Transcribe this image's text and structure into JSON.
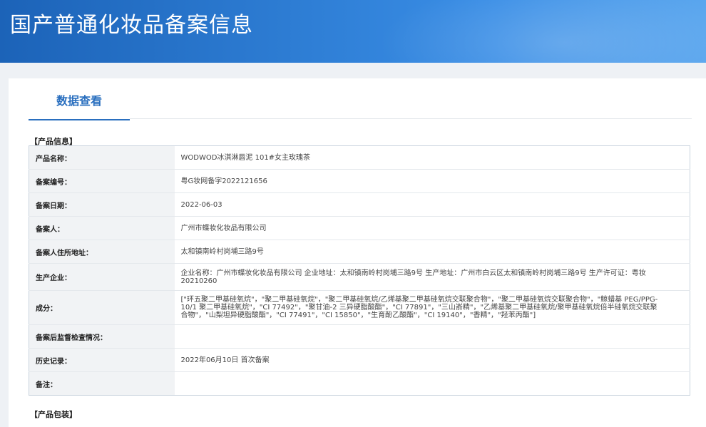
{
  "header": {
    "title": "国产普通化妆品备案信息"
  },
  "tab": {
    "label": "数据查看"
  },
  "sections": {
    "product_info": "【产品信息】",
    "product_package": "【产品包装】"
  },
  "rows": [
    {
      "label": "产品名称：",
      "value": "WODWOD冰淇淋唇泥 101#女主玫瑰茶"
    },
    {
      "label": "备案编号：",
      "value": "粤G妆网备字2022121656"
    },
    {
      "label": "备案日期：",
      "value": "2022-06-03"
    },
    {
      "label": "备案人：",
      "value": "广州市蝶妆化妆品有限公司"
    },
    {
      "label": "备案人住所地址：",
      "value": "太和镇南岭村岗埔三路9号"
    },
    {
      "label": "生产企业：",
      "value": "企业名称：广州市蝶妆化妆品有限公司 企业地址：太和镇南岭村岗埔三路9号 生产地址：广州市白云区太和镇南岭村岗埔三路9号 生产许可证：粤妆20210260"
    },
    {
      "label": "成分：",
      "value": "[\"环五聚二甲基硅氧烷\"，\"聚二甲基硅氧烷\"，\"聚二甲基硅氧烷/乙烯基聚二甲基硅氧烷交联聚合物\"，\"聚二甲基硅氧烷交联聚合物\"，\"鲸蜡基 PEG/PPG-10/1 聚二甲基硅氧烷\"，\"CI 77492\"，\"聚甘油-2 三异硬脂酸酯\"，\"CI 77891\"，\"三山嵛精\"，\"乙烯基聚二甲基硅氧烷/聚甲基硅氧烷倍半硅氧烷交联聚合物\"，\"山梨坦异硬脂酸酯\"，\"CI 77491\"，\"CI 15850\"，\"生育酚乙酸酯\"，\"CI 19140\"，\"香精\"，\"羟苯丙酯\"]"
    },
    {
      "label": "备案后监督检查情况：",
      "value": ""
    },
    {
      "label": "历史记录：",
      "value": "2022年06月10日 首次备案"
    },
    {
      "label": "备注：",
      "value": ""
    }
  ]
}
